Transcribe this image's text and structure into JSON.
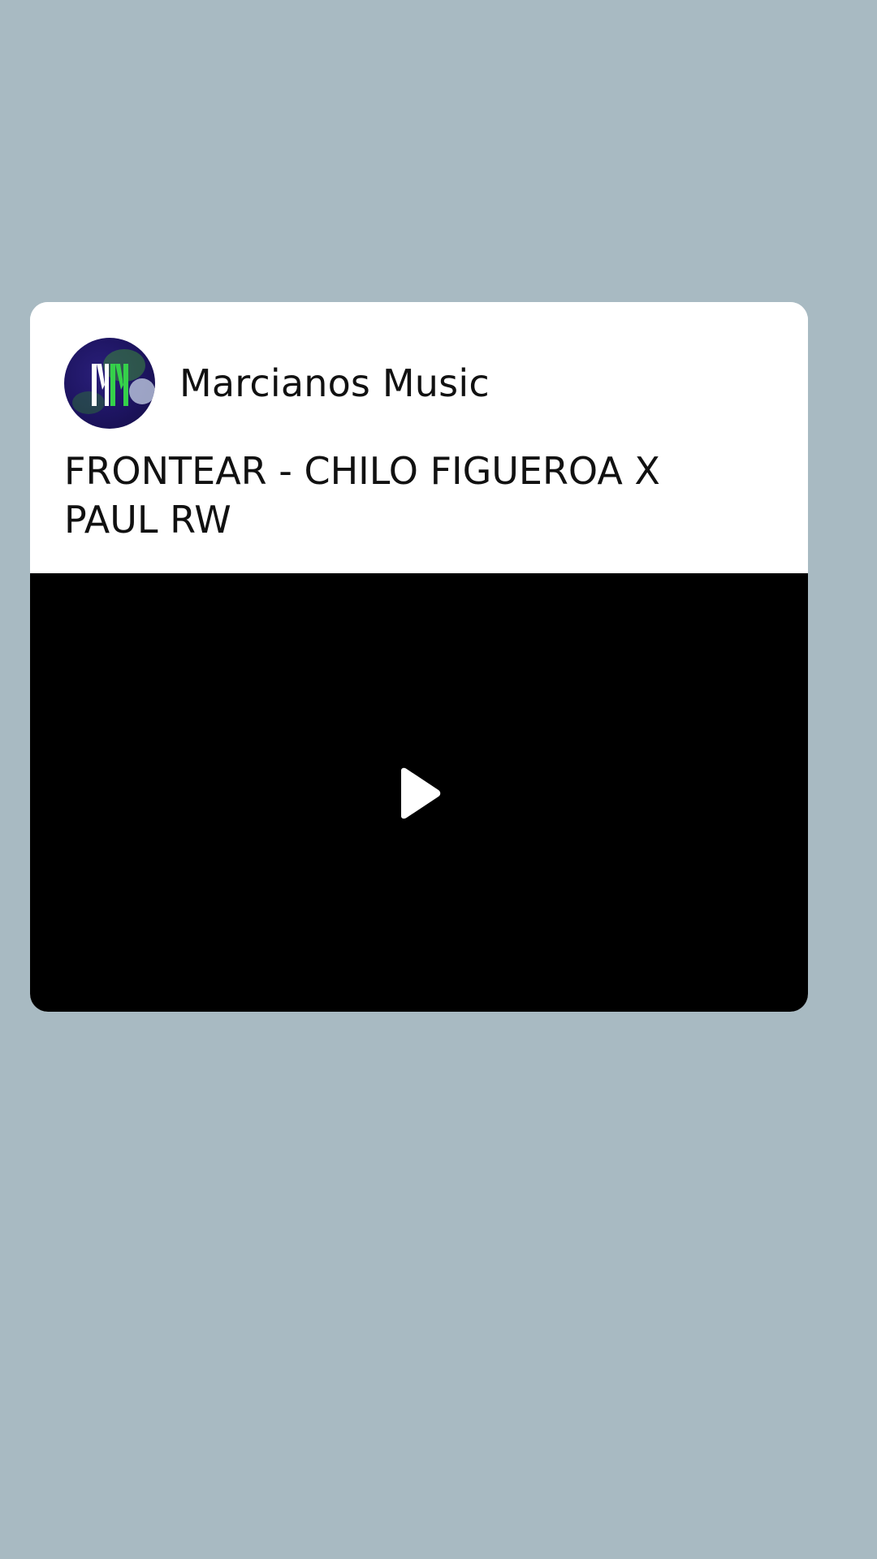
{
  "background_color": "#a8bac2",
  "card": {
    "channel": {
      "name": "Marcianos Music",
      "avatar_icon": "marcianos-music-logo-icon"
    },
    "video": {
      "title": "FRONTEAR - CHILO FIGUEROA X PAUL RW",
      "play_icon": "play-icon",
      "player_color": "#000000"
    }
  }
}
